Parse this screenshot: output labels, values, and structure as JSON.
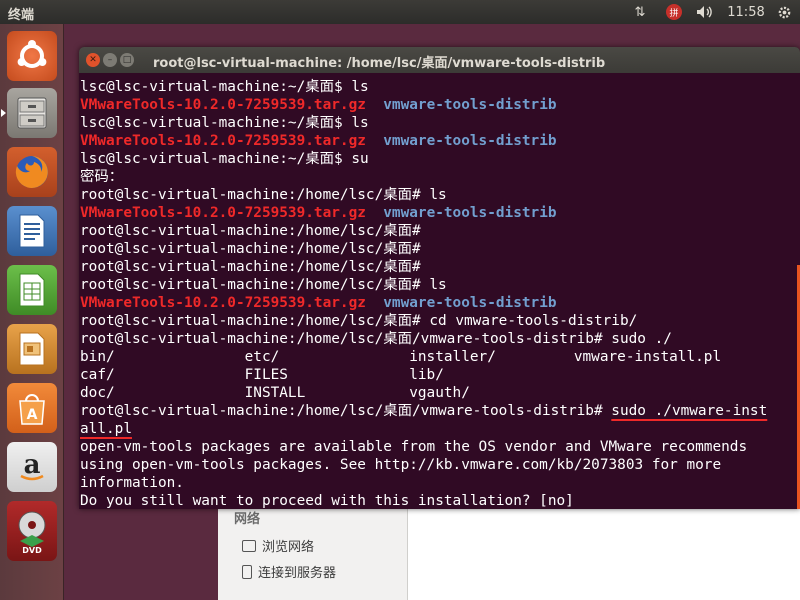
{
  "top_panel": {
    "title": "终端",
    "input_method": "拼",
    "clock": "11:58"
  },
  "launcher": {
    "items": [
      {
        "name": "dash-home",
        "icon": "ubuntu-logo-icon"
      },
      {
        "name": "files",
        "icon": "file-cabinet-icon"
      },
      {
        "name": "firefox",
        "icon": "firefox-icon"
      },
      {
        "name": "writer",
        "icon": "writer-document-icon"
      },
      {
        "name": "calc",
        "icon": "calc-spreadsheet-icon"
      },
      {
        "name": "impress",
        "icon": "impress-presentation-icon"
      },
      {
        "name": "software-center",
        "icon": "shopping-bag-icon"
      },
      {
        "name": "amazon",
        "icon": "amazon-icon"
      },
      {
        "name": "dvd-installer",
        "icon": "dvd-icon"
      }
    ],
    "amazon_letter": "a",
    "software_letter": "A",
    "dvd_label": "DVD"
  },
  "file_manager": {
    "section": "网络",
    "items": [
      "浏览网络",
      "连接到服务器"
    ]
  },
  "terminal": {
    "title": "root@lsc-virtual-machine: /home/lsc/桌面/vmware-tools-distrib",
    "lines": [
      [
        {
          "t": "lsc@lsc-virtual-machine:~/桌面$ ls"
        }
      ],
      [
        {
          "t": "VMwareTools-10.2.0-7259539.tar.gz",
          "c": "red"
        },
        {
          "t": "  "
        },
        {
          "t": "vmware-tools-distrib",
          "c": "blue"
        }
      ],
      [
        {
          "t": "lsc@lsc-virtual-machine:~/桌面$ ls"
        }
      ],
      [
        {
          "t": "VMwareTools-10.2.0-7259539.tar.gz",
          "c": "red"
        },
        {
          "t": "  "
        },
        {
          "t": "vmware-tools-distrib",
          "c": "blue"
        }
      ],
      [
        {
          "t": "lsc@lsc-virtual-machine:~/桌面$ su"
        }
      ],
      [
        {
          "t": "密码："
        }
      ],
      [
        {
          "t": "root@lsc-virtual-machine:/home/lsc/桌面# ls"
        }
      ],
      [
        {
          "t": "VMwareTools-10.2.0-7259539.tar.gz",
          "c": "red"
        },
        {
          "t": "  "
        },
        {
          "t": "vmware-tools-distrib",
          "c": "blue"
        }
      ],
      [
        {
          "t": "root@lsc-virtual-machine:/home/lsc/桌面#"
        }
      ],
      [
        {
          "t": "root@lsc-virtual-machine:/home/lsc/桌面#"
        }
      ],
      [
        {
          "t": "root@lsc-virtual-machine:/home/lsc/桌面#"
        }
      ],
      [
        {
          "t": "root@lsc-virtual-machine:/home/lsc/桌面# ls"
        }
      ],
      [
        {
          "t": "VMwareTools-10.2.0-7259539.tar.gz",
          "c": "red"
        },
        {
          "t": "  "
        },
        {
          "t": "vmware-tools-distrib",
          "c": "blue"
        }
      ],
      [
        {
          "t": "root@lsc-virtual-machine:/home/lsc/桌面# cd vmware-tools-distrib/"
        }
      ],
      [
        {
          "t": "root@lsc-virtual-machine:/home/lsc/桌面/vmware-tools-distrib# sudo ./"
        }
      ],
      [
        {
          "t": "bin/               etc/               installer/         vmware-install.pl"
        }
      ],
      [
        {
          "t": "caf/               FILES              lib/"
        }
      ],
      [
        {
          "t": "doc/               INSTALL            vgauth/"
        }
      ],
      [
        {
          "t": "root@lsc-virtual-machine:/home/lsc/桌面/vmware-tools-distrib# "
        },
        {
          "t": "sudo ./vmware-inst",
          "c": "ul"
        }
      ],
      [
        {
          "t": "all.pl",
          "c": "ul"
        }
      ],
      [
        {
          "t": "open-vm-tools packages are available from the OS vendor and VMware recommends"
        }
      ],
      [
        {
          "t": "using open-vm-tools packages. See http://kb.vmware.com/kb/2073803 for more"
        }
      ],
      [
        {
          "t": "information."
        }
      ],
      [
        {
          "t": "Do you still want to proceed with this installation? [no]"
        }
      ]
    ]
  }
}
